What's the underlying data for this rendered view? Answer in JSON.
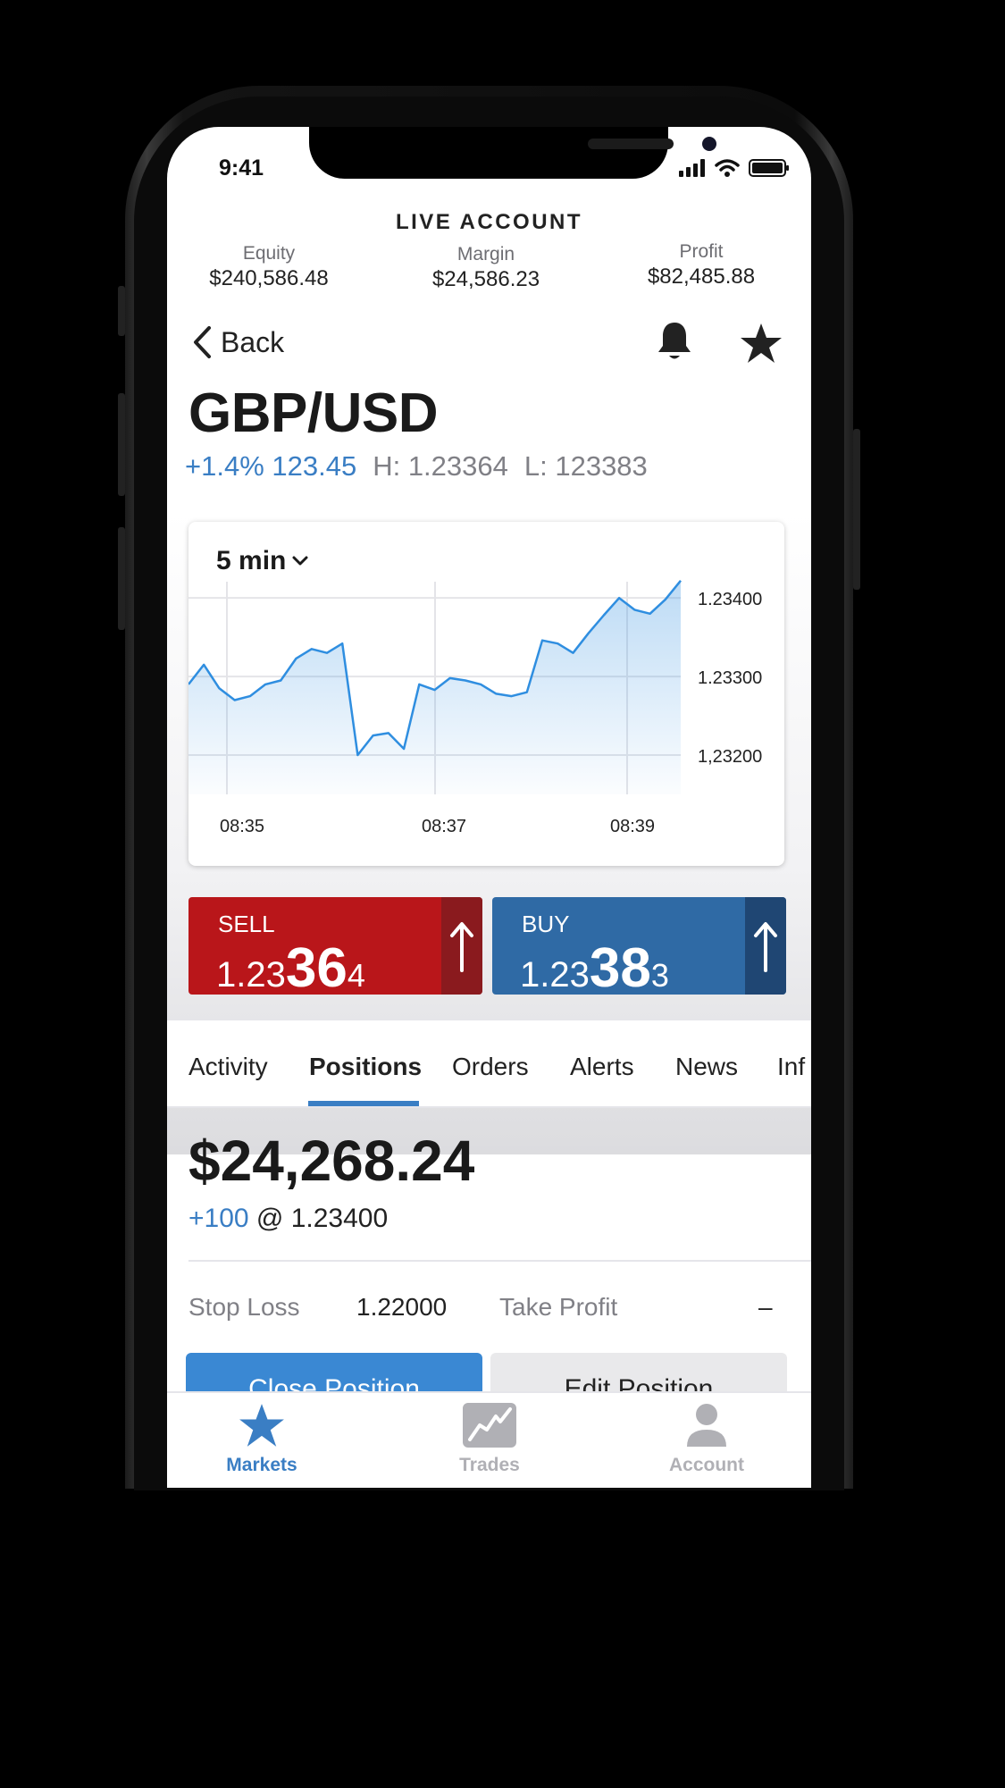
{
  "status_bar": {
    "time": "9:41"
  },
  "account": {
    "title": "LIVE ACCOUNT",
    "equity_label": "Equity",
    "equity_value": "$240,586.48",
    "margin_label": "Margin",
    "margin_value": "$24,586.23",
    "profit_label": "Profit",
    "profit_value": "$82,485.88"
  },
  "nav": {
    "back_label": "Back",
    "bell_icon": "bell-icon",
    "favorite_icon": "star-icon"
  },
  "instrument": {
    "pair": "GBP/USD",
    "change": "+1.4% 123.45",
    "high": "H: 1.23364",
    "low": "L: 123383"
  },
  "chart": {
    "timeframe": "5 min",
    "line_color": "#2f8ee0",
    "y_ticks": [
      "1.23400",
      "1.23300",
      "1,23200"
    ],
    "x_ticks": [
      "08:35",
      "08:37",
      "08:39"
    ]
  },
  "chart_data": {
    "type": "area",
    "title": "",
    "xlabel": "",
    "ylabel": "",
    "x_ticks": [
      "08:35",
      "08:37",
      "08:39"
    ],
    "y_ticks": [
      "1.23400",
      "1.23300",
      "1,23200"
    ],
    "ylim": [
      1.2315,
      1.2344
    ],
    "grid": true,
    "values": [
      1.2329,
      1.23315,
      1.23285,
      1.2327,
      1.23275,
      1.2329,
      1.23295,
      1.23323,
      1.23335,
      1.2333,
      1.23342,
      1.232,
      1.23225,
      1.23228,
      1.23208,
      1.2329,
      1.23283,
      1.23298,
      1.23295,
      1.2329,
      1.23278,
      1.23275,
      1.2328,
      1.23346,
      1.23342,
      1.2333,
      1.23355,
      1.23378,
      1.234,
      1.23385,
      1.2338,
      1.23398,
      1.23422
    ]
  },
  "trade": {
    "sell_label": "SELL",
    "sell_price_prefix": "1.23",
    "sell_price_big": "36",
    "sell_price_suffix": "4",
    "buy_label": "BUY",
    "buy_price_prefix": "1.23",
    "buy_price_big": "38",
    "buy_price_suffix": "3",
    "sell_color": "#b9161a",
    "buy_color": "#2f6aa5"
  },
  "tabs": {
    "items": [
      "Activity",
      "Positions",
      "Orders",
      "Alerts",
      "News",
      "Inf"
    ],
    "active": "Positions"
  },
  "position": {
    "pl": "$24,268.24",
    "qty": "+100",
    "at_price": " @ 1.23400",
    "stop_loss_label": "Stop Loss",
    "stop_loss_value": "1.22000",
    "take_profit_label": "Take Profit",
    "take_profit_value": "–",
    "close_label": "Close Position",
    "edit_label": "Edit Position"
  },
  "tabbar": {
    "items": [
      {
        "label": "Markets",
        "icon": "star-icon",
        "active": true
      },
      {
        "label": "Trades",
        "icon": "chart-icon",
        "active": false
      },
      {
        "label": "Account",
        "icon": "person-icon",
        "active": false
      }
    ],
    "accent": "#3a7ec4"
  }
}
